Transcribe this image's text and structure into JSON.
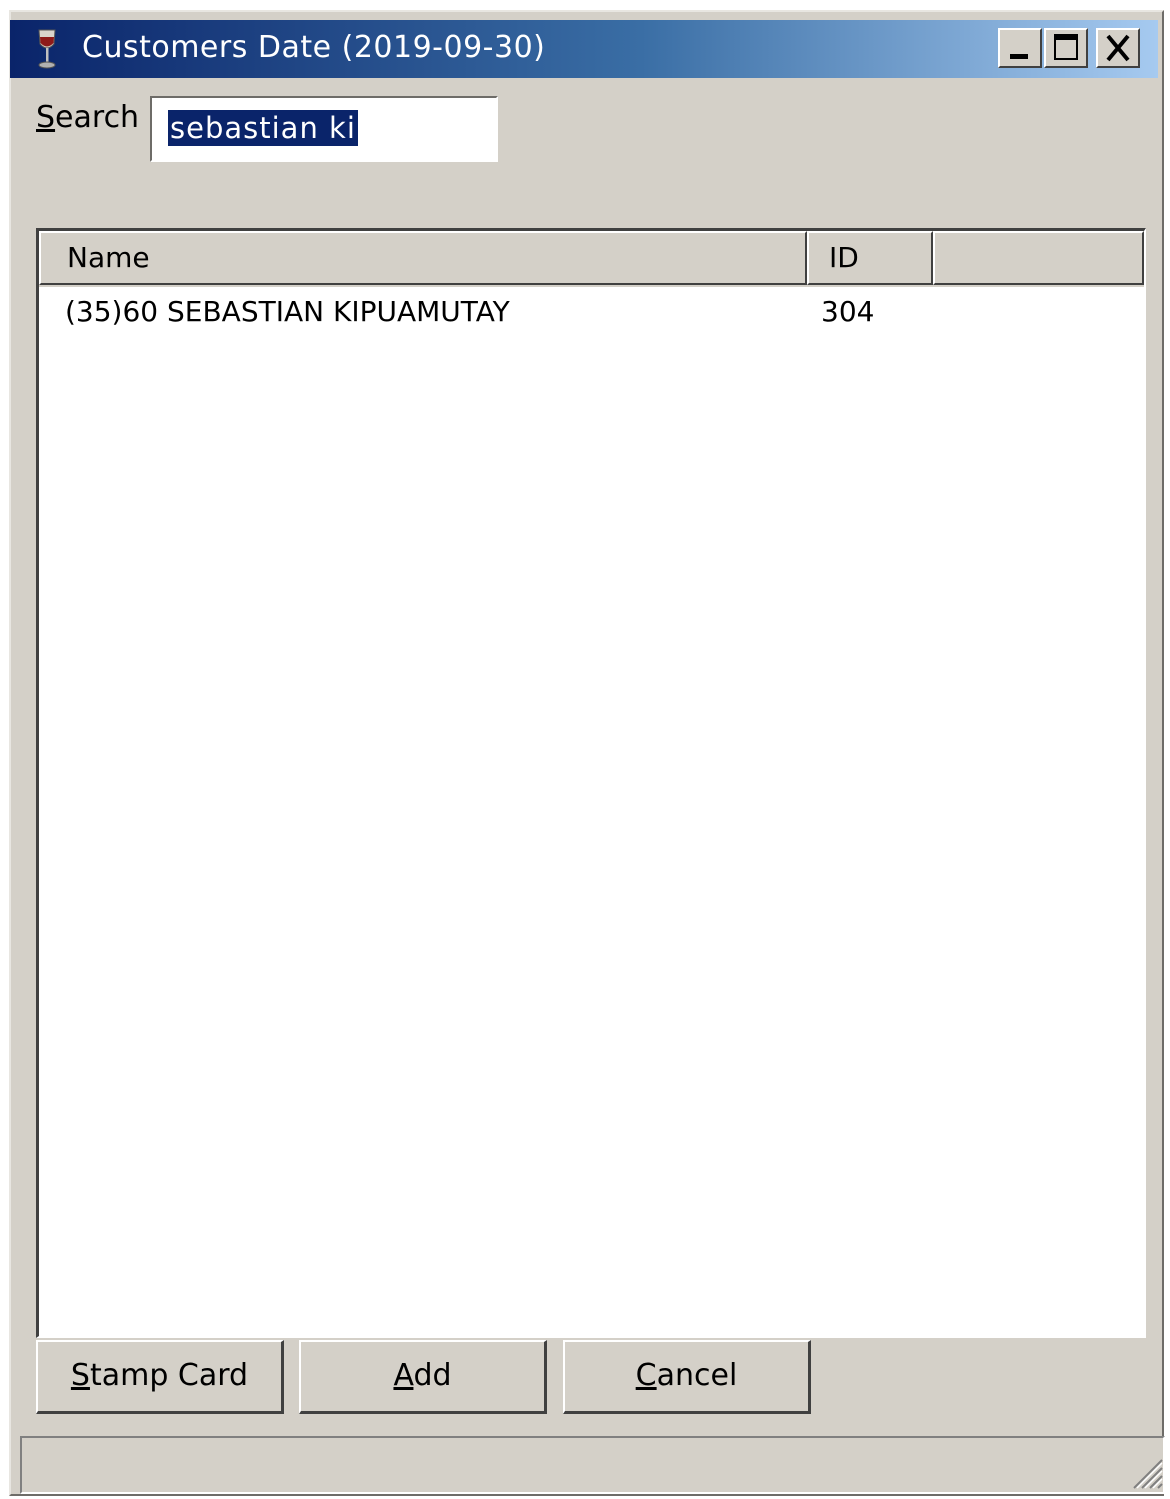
{
  "window": {
    "title": "Customers Date (2019-09-30)",
    "icon": "wine-glass-icon",
    "controls": {
      "minimize": "minimize-icon",
      "maximize": "maximize-icon",
      "close": "close-icon"
    }
  },
  "search": {
    "label_mnemonic": "S",
    "label_rest": "earch",
    "value": "sebastian ki"
  },
  "table": {
    "columns": [
      "Name",
      "ID",
      ""
    ],
    "rows": [
      {
        "name": "(35)60 SEBASTIAN KIPUAMUTAY",
        "id": "304"
      }
    ]
  },
  "buttons": {
    "stamp_card": {
      "mnemonic": "S",
      "rest": "tamp Card"
    },
    "add": {
      "mnemonic": "A",
      "rest": "dd"
    },
    "cancel": {
      "mnemonic": "C",
      "rest": "ancel"
    }
  },
  "colors": {
    "titlebar_start": "#0a246a",
    "titlebar_end": "#a6caf0",
    "window_bg": "#d4d0c8",
    "selection": "#0a246a"
  }
}
